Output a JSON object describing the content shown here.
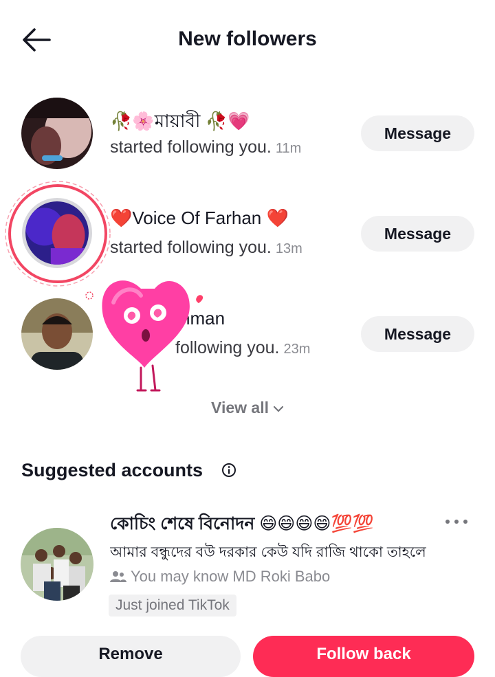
{
  "header": {
    "title": "New followers",
    "back_icon": "arrow-left-icon"
  },
  "followers": [
    {
      "name": "🥀🌸মায়াবী 🥀💗",
      "text": "started following you.",
      "time": "11m",
      "button": "Message"
    },
    {
      "name": "❤️Voice Of Farhan ❤️",
      "text": "started following you.",
      "time": "13m",
      "button": "Message"
    },
    {
      "name": "hman",
      "text": "following you.",
      "time": "23m",
      "button": "Message"
    }
  ],
  "view_all": "View all",
  "suggested": {
    "title": "Suggested accounts",
    "account": {
      "name": "কোচিং শেষে বিনোদন 😄😄😄😄💯💯",
      "bio": "আমার বন্ধুদের বউ  দরকার কেউ যদি রাজি থাকো তাহলে",
      "mutual": "You may know MD Roki Babo",
      "badge": "Just joined TikTok"
    },
    "remove_label": "Remove",
    "follow_label": "Follow back"
  },
  "colors": {
    "accent": "#fe2c55",
    "button_bg": "#f1f1f2",
    "sticker_pink": "#ff3fa4"
  }
}
